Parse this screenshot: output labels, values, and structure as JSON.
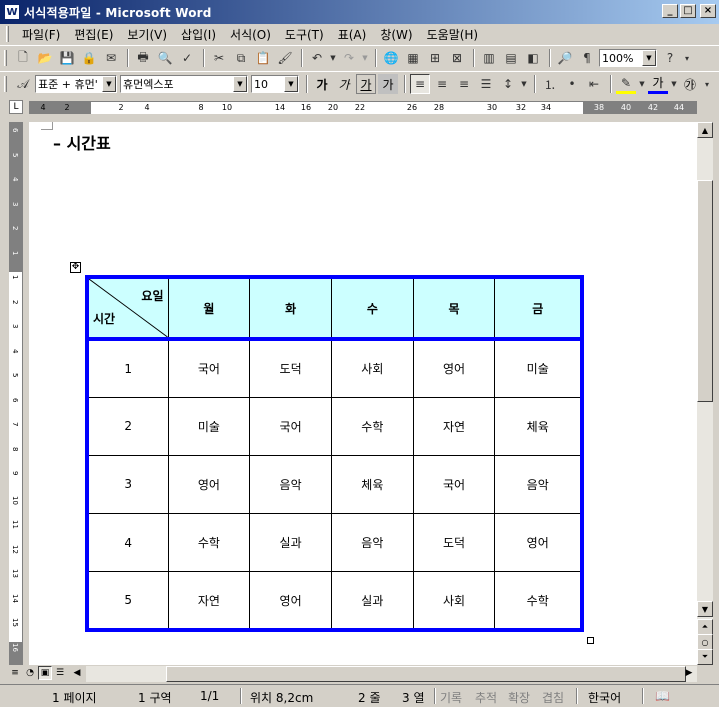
{
  "window": {
    "title": "서식적용파일 - Microsoft Word",
    "app_icon": "W"
  },
  "menu": [
    "파일(F)",
    "편집(E)",
    "보기(V)",
    "삽입(I)",
    "서식(O)",
    "도구(T)",
    "표(A)",
    "창(W)",
    "도움말(H)"
  ],
  "toolbar": {
    "zoom": "100%",
    "help": "?"
  },
  "format_bar": {
    "style": "표준 + 휴먼'",
    "font": "휴먼엑스포",
    "size": "10",
    "bold_glyph": "가",
    "italic_glyph": "가",
    "underline_glyph": "가",
    "char_glyph": "가",
    "font_color_glyph": "가",
    "enclose_glyph": "㉮"
  },
  "ruler": {
    "numbers": [
      "4",
      "2",
      "2",
      "4",
      "8",
      "10",
      "14",
      "16",
      "20",
      "22",
      "26",
      "28",
      "30",
      "32",
      "34",
      "38",
      "40",
      "42",
      "44"
    ],
    "vnumbers": [
      "6",
      "5",
      "4",
      "3",
      "2",
      "1",
      "1",
      "2",
      "3",
      "4",
      "5",
      "6",
      "7",
      "8",
      "9",
      "10",
      "11",
      "12",
      "13",
      "14",
      "15",
      "16"
    ]
  },
  "document": {
    "heading": "– 시간표",
    "table": {
      "corner_top": "요일",
      "corner_bottom": "시간",
      "days": [
        "월",
        "화",
        "수",
        "목",
        "금"
      ],
      "rows": [
        {
          "period": "1",
          "subjects": [
            "국어",
            "도덕",
            "사회",
            "영어",
            "미술"
          ]
        },
        {
          "period": "2",
          "subjects": [
            "미술",
            "국어",
            "수학",
            "자연",
            "체육"
          ]
        },
        {
          "period": "3",
          "subjects": [
            "영어",
            "음악",
            "체육",
            "국어",
            "음악"
          ]
        },
        {
          "period": "4",
          "subjects": [
            "수학",
            "실과",
            "음악",
            "도덕",
            "영어"
          ]
        },
        {
          "period": "5",
          "subjects": [
            "자연",
            "영어",
            "실과",
            "사회",
            "수학"
          ]
        }
      ]
    }
  },
  "status": {
    "page": "1 페이지",
    "section": "1 구역",
    "pages": "1/1",
    "position": "위치 8,2cm",
    "line": "2 줄",
    "column": "3 열",
    "rec": "기록",
    "trk": "추적",
    "ext": "확장",
    "ovr": "겹침",
    "language": "한국어"
  },
  "colors": {
    "table_border": "#0000ff",
    "header_fill": "#ccffff",
    "titlebar_start": "#0a246a",
    "titlebar_end": "#a6caf0"
  }
}
